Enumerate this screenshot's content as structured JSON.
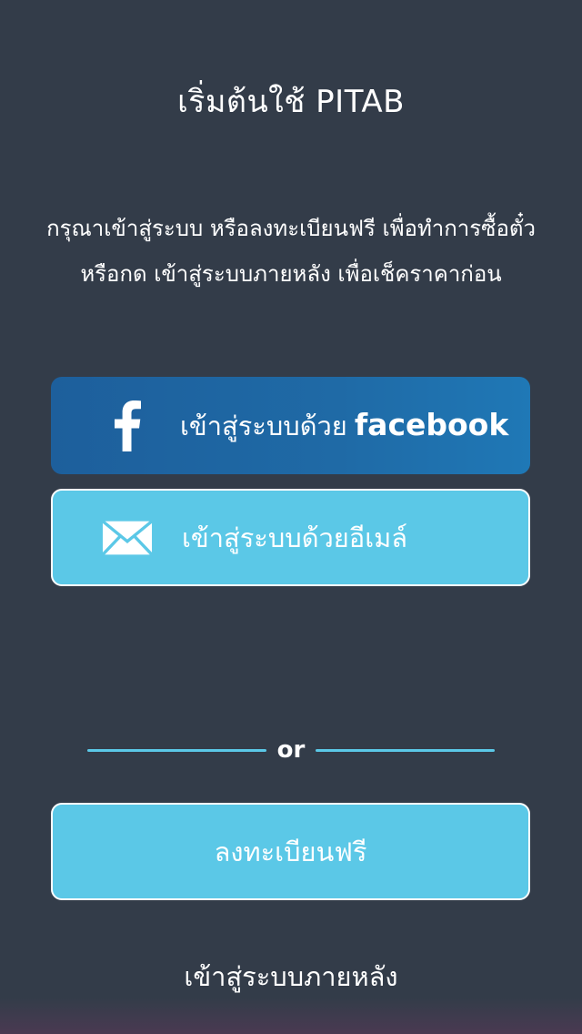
{
  "header": {
    "title": "เริ่มต้นใช้ PITAB"
  },
  "intro": {
    "text": "กรุณาเข้าสู่ระบบ หรือลงทะเบียนฟรี เพื่อทำการซื้อตั๋ว\nหรือกด เข้าสู่ระบบภายหลัง เพื่อเช็คราคาก่อน"
  },
  "facebook_login": {
    "label": "เข้าสู่ระบบด้วย",
    "brand": "facebook",
    "icon": "facebook-icon"
  },
  "email_login": {
    "label": "เข้าสู่ระบบด้วยอีเมล์",
    "icon": "envelope-icon"
  },
  "divider": {
    "text": "or"
  },
  "register": {
    "label": "ลงทะเบียนฟรี"
  },
  "later": {
    "label": "เข้าสู่ระบบภายหลัง"
  },
  "colors": {
    "background": "#333c49",
    "facebook_button": "#1f6aa6",
    "accent": "#5bc8e7",
    "text": "#ffffff"
  }
}
